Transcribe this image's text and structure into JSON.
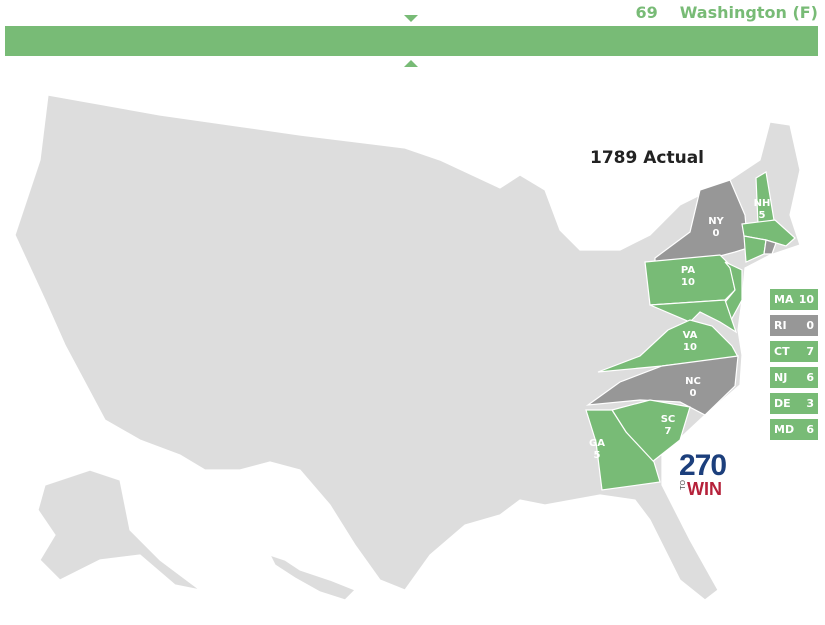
{
  "header": {
    "electoral_votes": "69",
    "candidate": "Washington (F)",
    "bar_color": "#78bb76"
  },
  "map": {
    "title": "1789 Actual",
    "colors": {
      "federalist": "#78bb76",
      "no_vote": "#979797",
      "not_participating": "#dddddd"
    },
    "states": [
      {
        "abbr": "NY",
        "votes": "0",
        "status": "no_vote"
      },
      {
        "abbr": "NH",
        "votes": "5",
        "status": "federalist"
      },
      {
        "abbr": "PA",
        "votes": "10",
        "status": "federalist"
      },
      {
        "abbr": "VA",
        "votes": "10",
        "status": "federalist"
      },
      {
        "abbr": "NC",
        "votes": "0",
        "status": "no_vote"
      },
      {
        "abbr": "SC",
        "votes": "7",
        "status": "federalist"
      },
      {
        "abbr": "GA",
        "votes": "5",
        "status": "federalist"
      }
    ],
    "small_states": [
      {
        "abbr": "MA",
        "votes": "10",
        "status": "federalist"
      },
      {
        "abbr": "RI",
        "votes": "0",
        "status": "no_vote"
      },
      {
        "abbr": "CT",
        "votes": "7",
        "status": "federalist"
      },
      {
        "abbr": "NJ",
        "votes": "6",
        "status": "federalist"
      },
      {
        "abbr": "DE",
        "votes": "3",
        "status": "federalist"
      },
      {
        "abbr": "MD",
        "votes": "6",
        "status": "federalist"
      }
    ]
  },
  "logo": {
    "number": "270",
    "to": "TO",
    "win": "WIN"
  }
}
